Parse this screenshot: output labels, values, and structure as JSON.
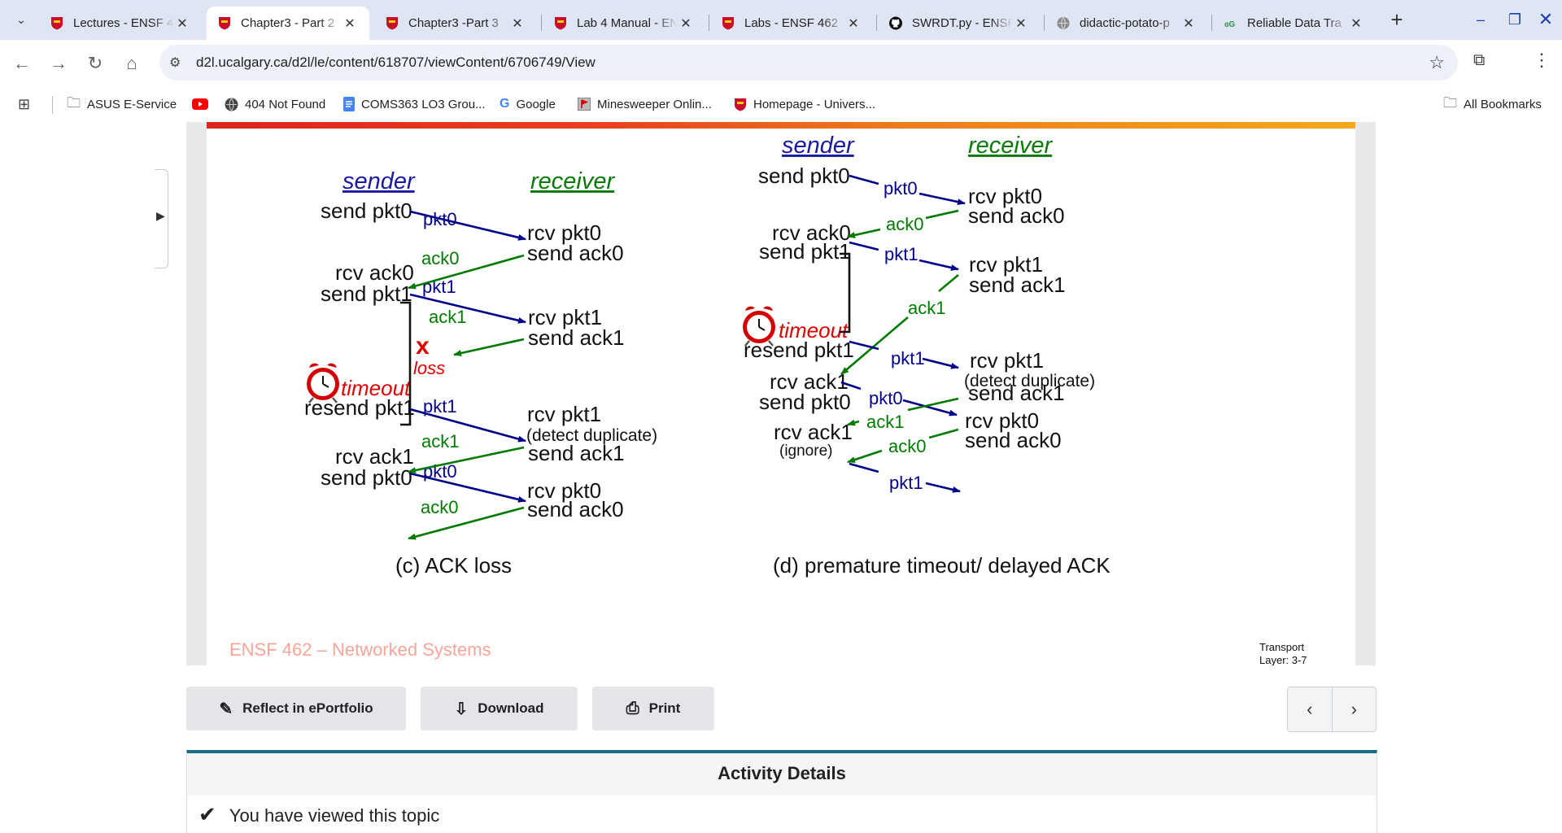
{
  "browser": {
    "tabs": [
      {
        "title": "Lectures - ENSF 462",
        "icon": "ucalgary-shield"
      },
      {
        "title": "Chapter3 - Part 2",
        "icon": "ucalgary-shield",
        "active": true
      },
      {
        "title": "Chapter3 -Part 3",
        "icon": "ucalgary-shield"
      },
      {
        "title": "Lab 4 Manual - ENSF",
        "icon": "ucalgary-shield"
      },
      {
        "title": "Labs - ENSF 462",
        "icon": "ucalgary-shield"
      },
      {
        "title": "SWRDT.py - ENSF",
        "icon": "github"
      },
      {
        "title": "didactic-potato-p",
        "icon": "globe"
      },
      {
        "title": "Reliable Data Tra",
        "icon": "geeksforgeeks"
      }
    ],
    "new_tab_label": "+",
    "url": "d2l.ucalgary.ca/d2l/le/content/618707/viewContent/6706749/View",
    "bookmarks": [
      {
        "label": "ASUS E-Service",
        "icon": "folder"
      },
      {
        "label": "",
        "icon": "youtube"
      },
      {
        "label": "404 Not Found",
        "icon": "globe"
      },
      {
        "label": "COMS363 LO3 Grou...",
        "icon": "docs"
      },
      {
        "label": "Google",
        "icon": "google"
      },
      {
        "label": "Minesweeper Onlin...",
        "icon": "minesweeper"
      },
      {
        "label": "Homepage - Univers...",
        "icon": "ucalgary-shield"
      }
    ],
    "all_bookmarks_label": "All Bookmarks"
  },
  "slide": {
    "left": {
      "sender_heading": "sender",
      "receiver_heading": "receiver",
      "send_pkt0": "send pkt0",
      "msg_pkt0_a": "pkt0",
      "rcv_pkt0_a": "rcv pkt0",
      "send_ack0_a": "send ack0",
      "msg_ack0_a": "ack0",
      "rcv_ack0": "rcv ack0",
      "send_pkt1": "send pkt1",
      "msg_pkt1_a": "pkt1",
      "rcv_pkt1_a": "rcv pkt1",
      "send_ack1_a": "send ack1",
      "msg_ack1_a": "ack1",
      "loss_mark": "x",
      "loss_label": "loss",
      "timeout": "timeout",
      "resend_pkt1": "resend pkt1",
      "msg_pkt1_b": "pkt1",
      "rcv_pkt1_b": "rcv pkt1",
      "detect_dup": "(detect duplicate)",
      "send_ack1_b": "send ack1",
      "msg_ack1_b": "ack1",
      "rcv_ack1": "rcv ack1",
      "send_pkt0_b": "send pkt0",
      "msg_pkt0_b": "pkt0",
      "rcv_pkt0_b": "rcv pkt0",
      "send_ack0_b": "send ack0",
      "msg_ack0_b": "ack0",
      "caption": "(c) ACK loss"
    },
    "right": {
      "sender_heading": "sender",
      "receiver_heading": "receiver",
      "send_pkt0": "send pkt0",
      "msg_pkt0_a": "pkt0",
      "rcv_pkt0_a": "rcv pkt0",
      "send_ack0_a": "send ack0",
      "msg_ack0_a": "ack0",
      "rcv_ack0": "rcv ack0",
      "send_pkt1": "send pkt1",
      "msg_pkt1_a": "pkt1",
      "rcv_pkt1_a": "rcv pkt1",
      "send_ack1_a": "send ack1",
      "msg_ack1_a": "ack1",
      "timeout": "timeout",
      "resend_pkt1": "resend pkt1",
      "msg_pkt1_b": "pkt1",
      "rcv_pkt1_b": "rcv pkt1",
      "detect_dup": "(detect duplicate)",
      "send_ack1_b": "send ack1",
      "rcv_ack1_a": "rcv ack1",
      "send_pkt0_b": "send pkt0",
      "msg_pkt0_b": "pkt0",
      "msg_ack1_b": "ack1",
      "rcv_pkt0_b": "rcv pkt0",
      "send_ack0_b": "send ack0",
      "rcv_ack1_b": "rcv ack1",
      "ignore": "(ignore)",
      "msg_ack0_b": "ack0",
      "msg_pkt1_c": "pkt1",
      "caption": "(d) premature timeout/ delayed ACK"
    },
    "footer_course": "ENSF 462 – Networked Systems",
    "footer_slide": "Transport Layer: 3-7",
    "colors": {
      "pkt": "#00008b",
      "ack": "#007a00",
      "timeout": "#e00000"
    }
  },
  "actions": {
    "reflect": "Reflect in ePortfolio",
    "download": "Download",
    "print": "Print",
    "prev": "‹",
    "next": "›"
  },
  "activity": {
    "heading": "Activity Details",
    "viewed": "You have viewed this topic"
  }
}
